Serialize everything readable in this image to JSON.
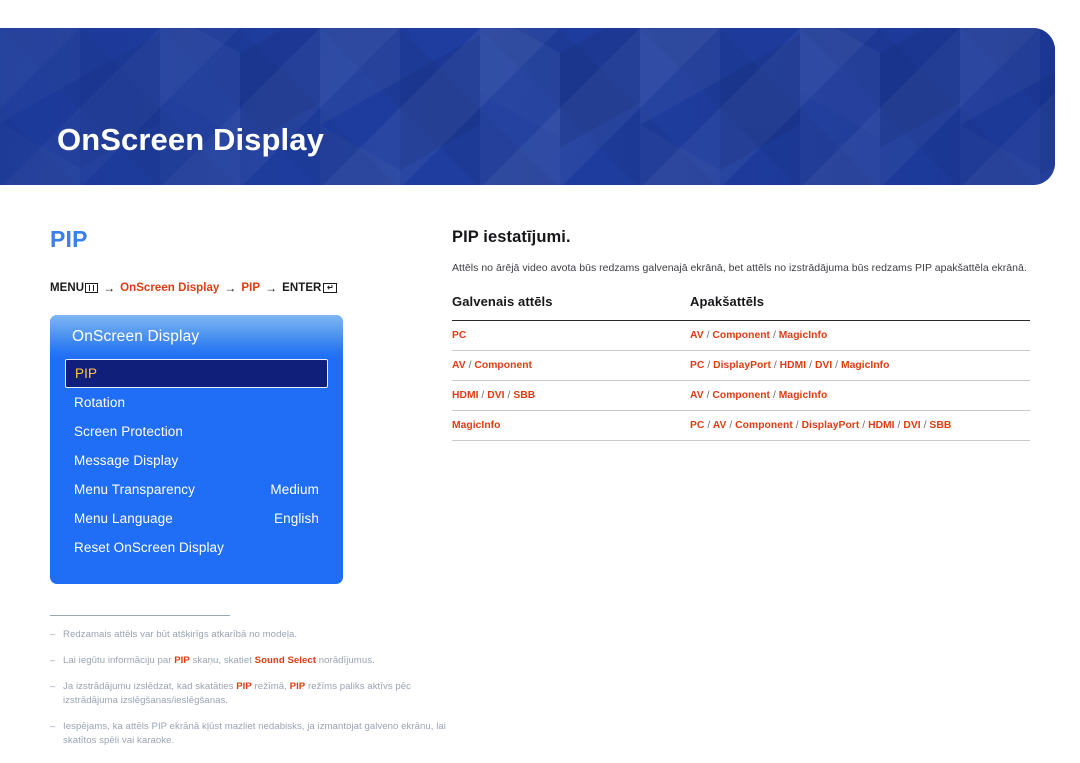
{
  "banner": {
    "title": "OnScreen Display",
    "bg_color": "#1f3d9e"
  },
  "left": {
    "section_title": "PIP",
    "accent_color": "#3d7fe8",
    "breadcrumb": {
      "menu_label": "MENU",
      "menu_icon": "menu-grid-icon",
      "arrow": "→",
      "step1": "OnScreen Display",
      "step2": "PIP",
      "enter_label": "ENTER",
      "enter_icon": "enter-return-icon",
      "enter_glyph": "↵",
      "highlight_color": "#e03c13"
    },
    "osd": {
      "header": "OnScreen Display",
      "items": [
        {
          "label": "PIP",
          "value": "",
          "selected": true
        },
        {
          "label": "Rotation",
          "value": "",
          "selected": false
        },
        {
          "label": "Screen Protection",
          "value": "",
          "selected": false
        },
        {
          "label": "Message Display",
          "value": "",
          "selected": false
        },
        {
          "label": "Menu Transparency",
          "value": "Medium",
          "selected": false
        },
        {
          "label": "Menu Language",
          "value": "English",
          "selected": false
        },
        {
          "label": "Reset OnScreen Display",
          "value": "",
          "selected": false
        }
      ],
      "panel_color": "#1f6ef5",
      "selected_bg": "#10207a",
      "selected_text_color": "#ffc73c"
    }
  },
  "notes": [
    {
      "dash": "–",
      "parts": [
        {
          "text": "Redzamais attēls var būt atšķirīgs atkarībā no modeļa.",
          "highlight": false
        }
      ]
    },
    {
      "dash": "–",
      "parts": [
        {
          "text": "Lai iegūtu informāciju par ",
          "highlight": false
        },
        {
          "text": "PIP",
          "highlight": true
        },
        {
          "text": " skaņu, skatiet ",
          "highlight": false
        },
        {
          "text": "Sound Select",
          "highlight": true
        },
        {
          "text": " norādījumus.",
          "highlight": false
        }
      ]
    },
    {
      "dash": "–",
      "parts": [
        {
          "text": "Ja izstrādājumu izslēdzat, kad skatāties ",
          "highlight": false
        },
        {
          "text": "PIP",
          "highlight": true
        },
        {
          "text": " režīmā, ",
          "highlight": false
        },
        {
          "text": "PIP",
          "highlight": true
        },
        {
          "text": " režīms paliks aktīvs pēc izstrādājuma izslēgšanas/ieslēgšanas.",
          "highlight": false
        }
      ]
    },
    {
      "dash": "–",
      "parts": [
        {
          "text": "Iespējams, ka attēls PIP ekrānā kļūst mazliet nedabisks, ja izmantojat galveno ekrānu, lai skatītos spēli vai karaoke.",
          "highlight": false
        }
      ]
    }
  ],
  "right": {
    "title": "PIP iestatījumi.",
    "description": "Attēls no ārējā video avota būs redzams galvenajā ekrānā, bet attēls no izstrādājuma būs redzams PIP apakšattēla ekrānā.",
    "table": {
      "columns": [
        "Galvenais attēls",
        "Apakšattēls"
      ],
      "rows": [
        {
          "main": "PC",
          "sub": "AV / Component / MagicInfo"
        },
        {
          "main": "AV / Component",
          "sub": "PC / DisplayPort / HDMI / DVI / MagicInfo"
        },
        {
          "main": "HDMI / DVI / SBB",
          "sub": "AV / Component / MagicInfo"
        },
        {
          "main": "MagicInfo",
          "sub": "PC / AV / Component / DisplayPort / HDMI / DVI / SBB"
        }
      ],
      "value_color": "#e03c13"
    }
  }
}
